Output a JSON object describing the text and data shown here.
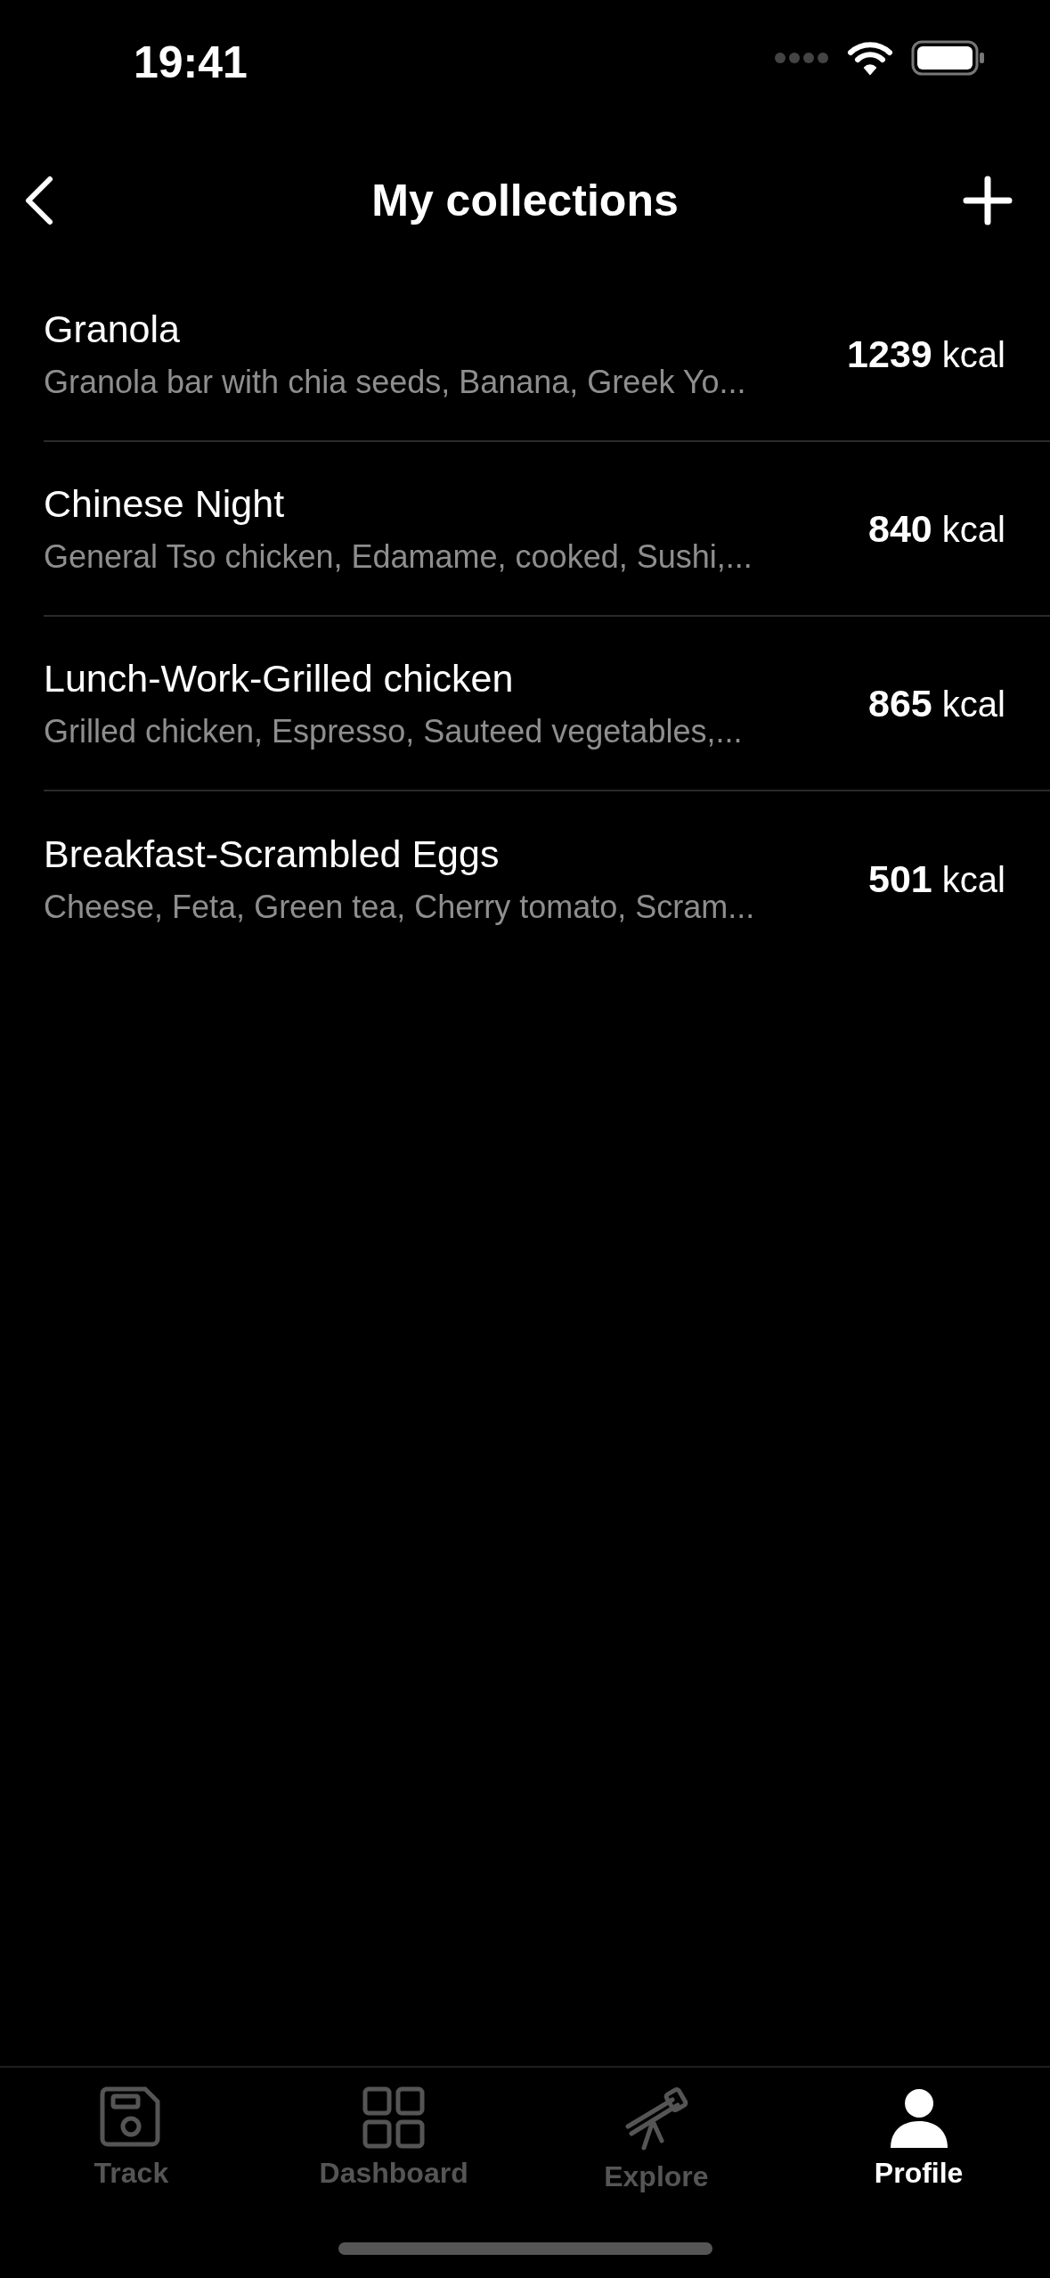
{
  "status_bar": {
    "time": "19:41"
  },
  "nav": {
    "title": "My collections"
  },
  "collections": [
    {
      "name": "Granola",
      "items": "Granola bar with chia seeds, Banana, Greek Yo...",
      "kcal": "1239",
      "unit": "kcal"
    },
    {
      "name": "Chinese Night",
      "items": "General Tso chicken, Edamame, cooked, Sushi,...",
      "kcal": "840",
      "unit": "kcal"
    },
    {
      "name": "Lunch-Work-Grilled chicken",
      "items": "Grilled chicken, Espresso, Sauteed vegetables,...",
      "kcal": "865",
      "unit": "kcal"
    },
    {
      "name": "Breakfast-Scrambled Eggs",
      "items": "Cheese, Feta, Green tea, Cherry tomato, Scram...",
      "kcal": "501",
      "unit": "kcal"
    }
  ],
  "tabs": [
    {
      "kind": "track",
      "label": "Track",
      "selected": false
    },
    {
      "kind": "dashboard",
      "label": "Dashboard",
      "selected": false
    },
    {
      "kind": "explore",
      "label": "Explore",
      "selected": false
    },
    {
      "kind": "profile",
      "label": "Profile",
      "selected": true
    }
  ]
}
